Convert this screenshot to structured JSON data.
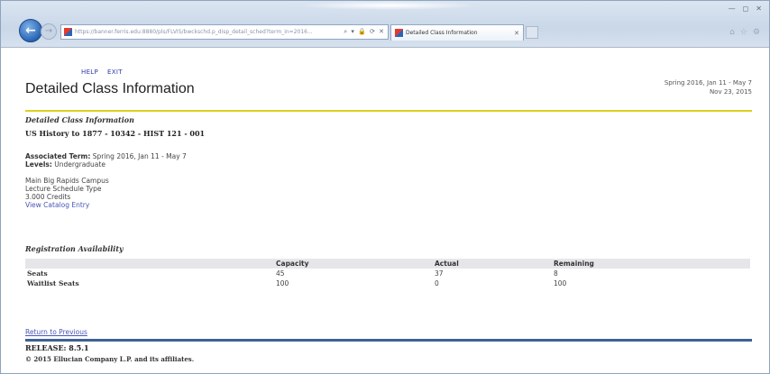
{
  "browser": {
    "url": "https://banner.ferris.edu:8880/pls/FLVIS/bwckschd.p_disp_detail_sched?term_in=2016...",
    "tab_title": "Detailed Class Information",
    "window_controls": [
      "—",
      "◻",
      "✕"
    ],
    "address_icons": "⌕ ▾ 🔒 ⟳ ✕",
    "toolbar_icons": [
      "⌂",
      "☆",
      "⚙"
    ]
  },
  "nav": {
    "help": "HELP",
    "exit": "EXIT"
  },
  "header": {
    "title": "Detailed Class Information",
    "term_dates": "Spring 2016, Jan 11 - May 7",
    "current_date": "Nov 23, 2015"
  },
  "section": {
    "title": "Detailed Class Information",
    "course_line": "US History to 1877 - 10342 - HIST 121 - 001",
    "associated_term_label": "Associated Term:",
    "associated_term_value": "Spring 2016, Jan 11 - May 7",
    "levels_label": "Levels:",
    "levels_value": "Undergraduate",
    "campus": "Main Big Rapids Campus",
    "schedule_type": "Lecture Schedule Type",
    "credits": "3.000 Credits",
    "catalog_link": "View Catalog Entry"
  },
  "registration": {
    "title": "Registration Availability",
    "columns": [
      "",
      "Capacity",
      "Actual",
      "Remaining"
    ],
    "rows": [
      {
        "label": "Seats",
        "capacity": "45",
        "actual": "37",
        "remaining": "8"
      },
      {
        "label": "Waitlist Seats",
        "capacity": "100",
        "actual": "0",
        "remaining": "100"
      }
    ]
  },
  "footer": {
    "return_link": "Return to Previous",
    "release": "RELEASE: 8.5.1",
    "copyright": "© 2015 Ellucian Company L.P. and its affiliates."
  },
  "colors": {
    "accent_rule": "#d9d21f",
    "footer_rule": "#3d6291",
    "link": "#4a56b8"
  }
}
